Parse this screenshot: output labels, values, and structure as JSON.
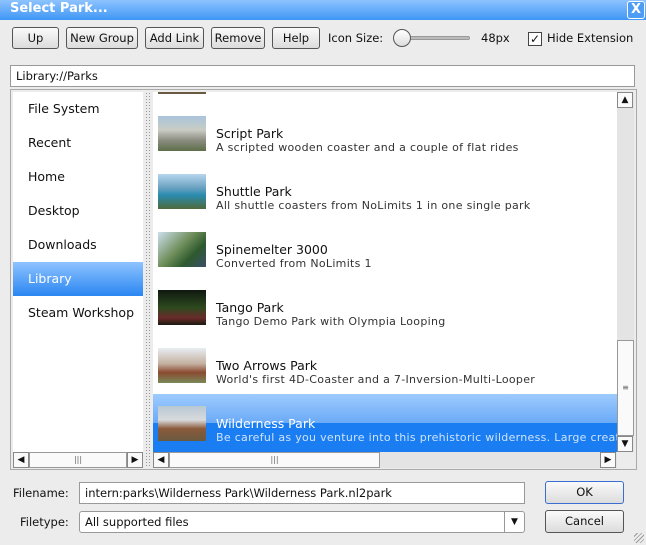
{
  "window": {
    "title": "Select Park...",
    "close": "X"
  },
  "toolbar": {
    "up": "Up",
    "new_group": "New Group",
    "add_link": "Add Link",
    "remove": "Remove",
    "help": "Help",
    "icon_size_label": "Icon Size:",
    "icon_size_value": "48px",
    "icon_size_fraction": 0.0,
    "hide_extension_label": "Hide Extension",
    "hide_extension_checked": true
  },
  "path": "Library://Parks",
  "sidebar": {
    "items": [
      {
        "label": "File System"
      },
      {
        "label": "Recent"
      },
      {
        "label": "Home"
      },
      {
        "label": "Desktop"
      },
      {
        "label": "Downloads"
      },
      {
        "label": "Library",
        "selected": true
      },
      {
        "label": "Steam Workshop"
      }
    ]
  },
  "parks": [
    {
      "name": "Script Park",
      "desc": "A scripted wooden coaster and a couple of flat rides"
    },
    {
      "name": "Shuttle Park",
      "desc": "All shuttle coasters from NoLimits 1 in one single park"
    },
    {
      "name": "Spinemelter 3000",
      "desc": "Converted from NoLimits 1"
    },
    {
      "name": "Tango Park",
      "desc": "Tango Demo Park with Olympia Looping"
    },
    {
      "name": "Two Arrows Park",
      "desc": "World's first 4D-Coaster and a 7-Inversion-Multi-Looper"
    },
    {
      "name": "Wilderness Park",
      "desc": "Be careful as you venture into this prehistoric wilderness. Large creatures roam",
      "selected": true
    }
  ],
  "footer": {
    "filename_label": "Filename:",
    "filename": "intern:parks\\Wilderness Park\\Wilderness Park.nl2park",
    "filetype_label": "Filetype:",
    "filetype": "All supported files",
    "ok": "OK",
    "cancel": "Cancel"
  }
}
